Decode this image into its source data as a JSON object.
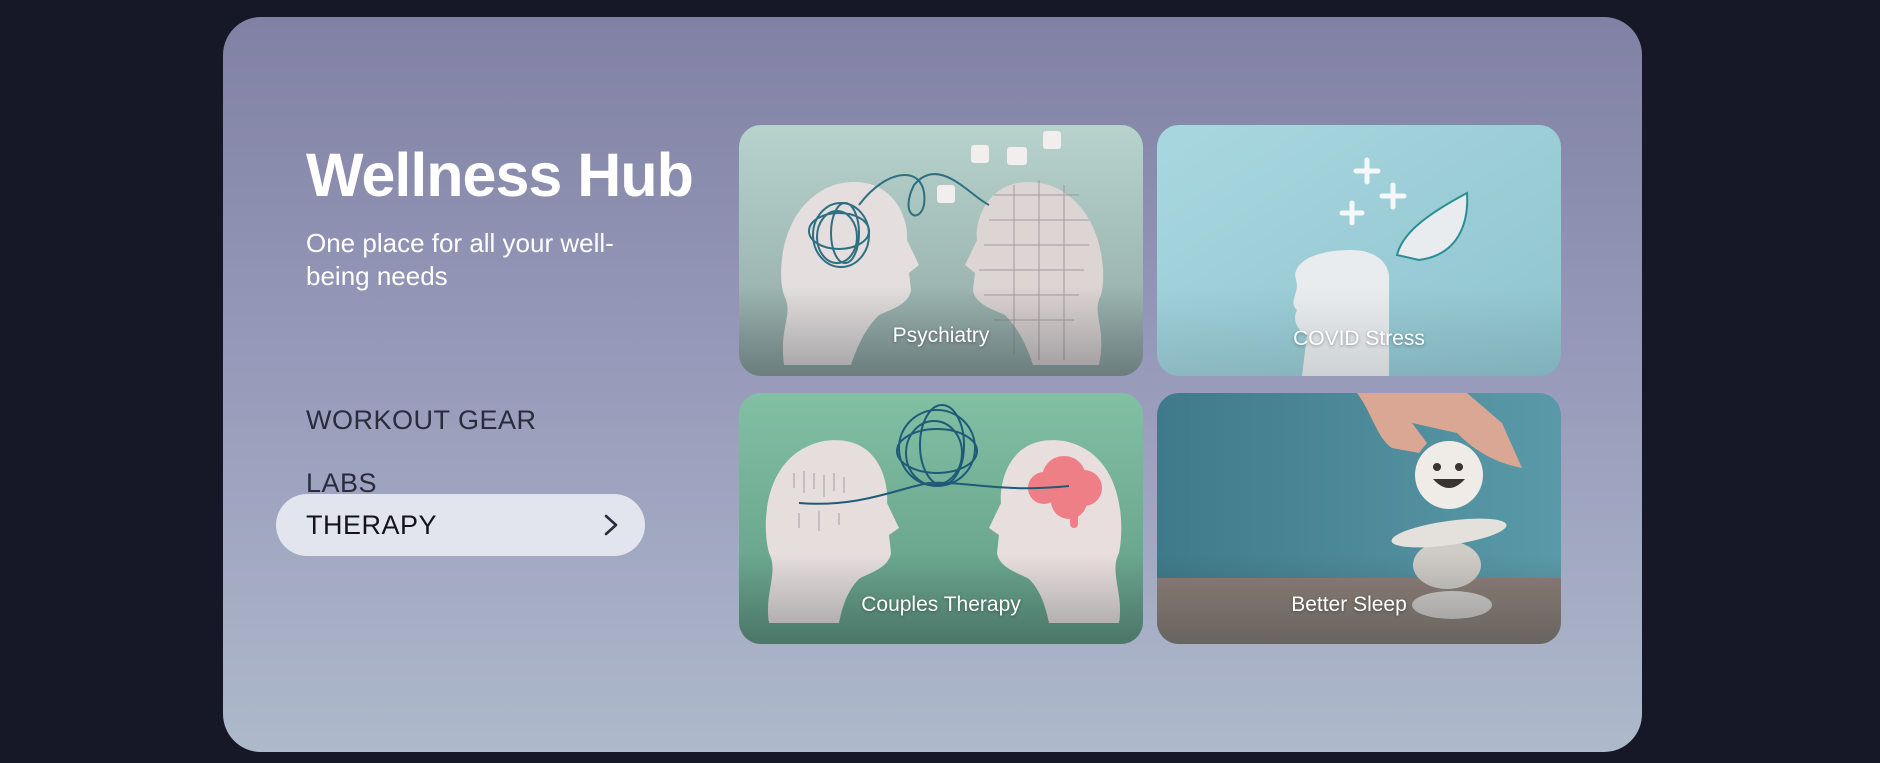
{
  "hero": {
    "title": "Wellness Hub",
    "subtitle": "One place for all your well-being needs"
  },
  "nav": {
    "items": [
      {
        "label": "WORKOUT GEAR",
        "active": false
      },
      {
        "label": "LABS",
        "active": false
      },
      {
        "label": "THERAPY",
        "active": true,
        "icon": "chevron-right-icon"
      }
    ]
  },
  "cards": [
    {
      "label": "Psychiatry",
      "image": "two-heads-tangled-thread-puzzle"
    },
    {
      "label": "COVID Stress",
      "image": "open-head-with-plus-signs"
    },
    {
      "label": "Couples Therapy",
      "image": "two-heads-tangled-thread-brain"
    },
    {
      "label": "Better Sleep",
      "image": "hand-stacking-smiling-stones"
    }
  ],
  "colors": {
    "page_background": "#161827",
    "panel_top": "#8081a4",
    "panel_bottom": "#aeb9cb",
    "active_pill": "#e2e5ee"
  }
}
